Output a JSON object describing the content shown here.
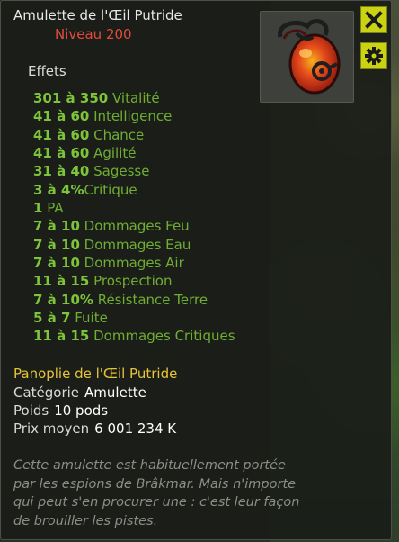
{
  "item": {
    "name": "Amulette de l'Œil Putride",
    "level": "Niveau  200"
  },
  "effects_title": "Effets",
  "effects": [
    {
      "value": "301 à 350",
      "label": "Vitalité"
    },
    {
      "value": "41 à 60",
      "label": "Intelligence"
    },
    {
      "value": "41 à 60",
      "label": "Chance"
    },
    {
      "value": "41 à 60",
      "label": "Agilité"
    },
    {
      "value": "31 à 40",
      "label": "Sagesse"
    },
    {
      "value": "3 à 4%",
      "label": "Critique"
    },
    {
      "value": "1",
      "label": "PA"
    },
    {
      "value": "7 à 10",
      "label": "Dommages Feu"
    },
    {
      "value": "7 à 10",
      "label": "Dommages Eau"
    },
    {
      "value": "7 à 10",
      "label": "Dommages Air"
    },
    {
      "value": "11 à 15",
      "label": "Prospection"
    },
    {
      "value": "7 à 10%",
      "label": "Résistance Terre"
    },
    {
      "value": "5 à 7",
      "label": "Fuite"
    },
    {
      "value": "11 à 15",
      "label": "Dommages Critiques"
    }
  ],
  "panoply": "Panoplie de l'Œil Putride",
  "category": {
    "label": "Catégorie",
    "value": "Amulette"
  },
  "weight": {
    "label": "Poids",
    "value": "10 pods"
  },
  "price": {
    "label": "Prix moyen",
    "value": "6 001 234 K"
  },
  "description": [
    "Cette amulette est habituellement portée",
    "par les espions de Brâkmar. Mais n'importe",
    "qui peut s'en procurer une : c'est leur façon",
    "de brouiller les pistes."
  ],
  "buttons": {
    "close_icon": "close-icon",
    "settings_icon": "gear-icon"
  },
  "colors": {
    "stat_value": "#7ec43b",
    "stat_label": "#6fae33",
    "level": "#e34a3e",
    "panoply": "#e6c43a",
    "button_bg": "#c9d213"
  }
}
